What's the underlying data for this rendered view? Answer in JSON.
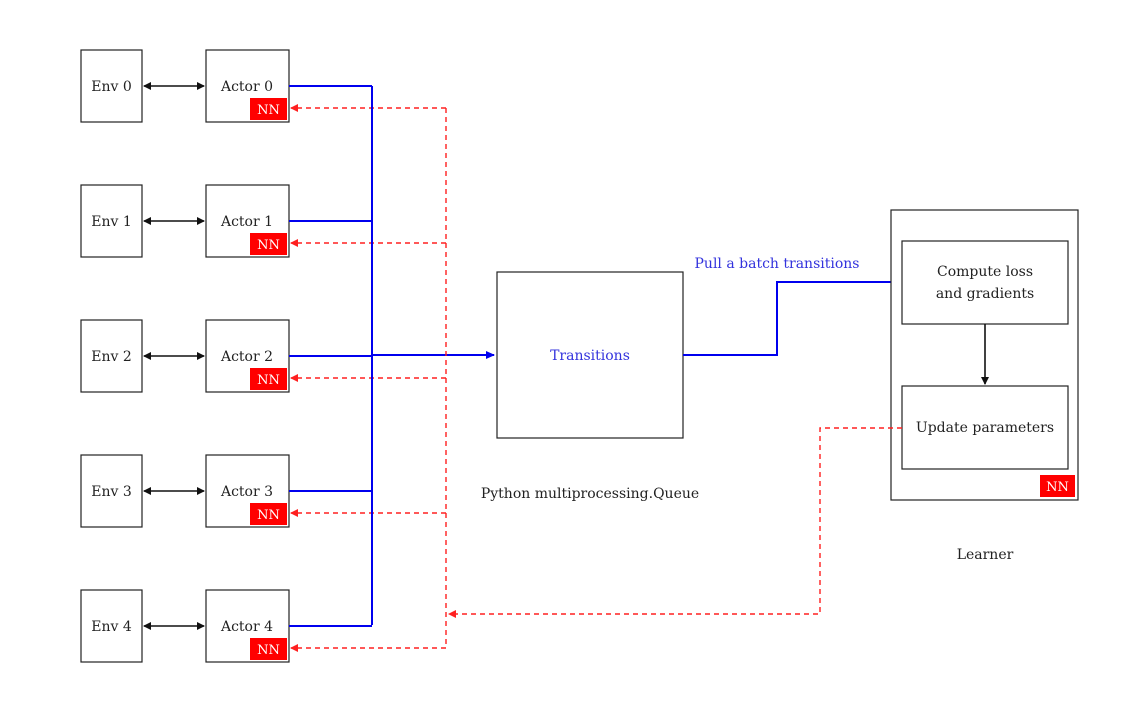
{
  "envs": [
    "Env 0",
    "Env 1",
    "Env 2",
    "Env 3",
    "Env 4"
  ],
  "actors": [
    "Actor 0",
    "Actor 1",
    "Actor 2",
    "Actor 3",
    "Actor 4"
  ],
  "nn_label": "NN",
  "queue": {
    "box_label": "Transitions",
    "caption": "Python multiprocessing.Queue"
  },
  "pull_label": "Pull a batch transitions",
  "learner": {
    "compute_line1": "Compute loss",
    "compute_line2": "and gradients",
    "update_label": "Update parameters",
    "caption": "Learner"
  },
  "colors": {
    "data_flow": "#0000ee",
    "param_sync": "#ff2020",
    "nn_badge": "#ff0000"
  }
}
